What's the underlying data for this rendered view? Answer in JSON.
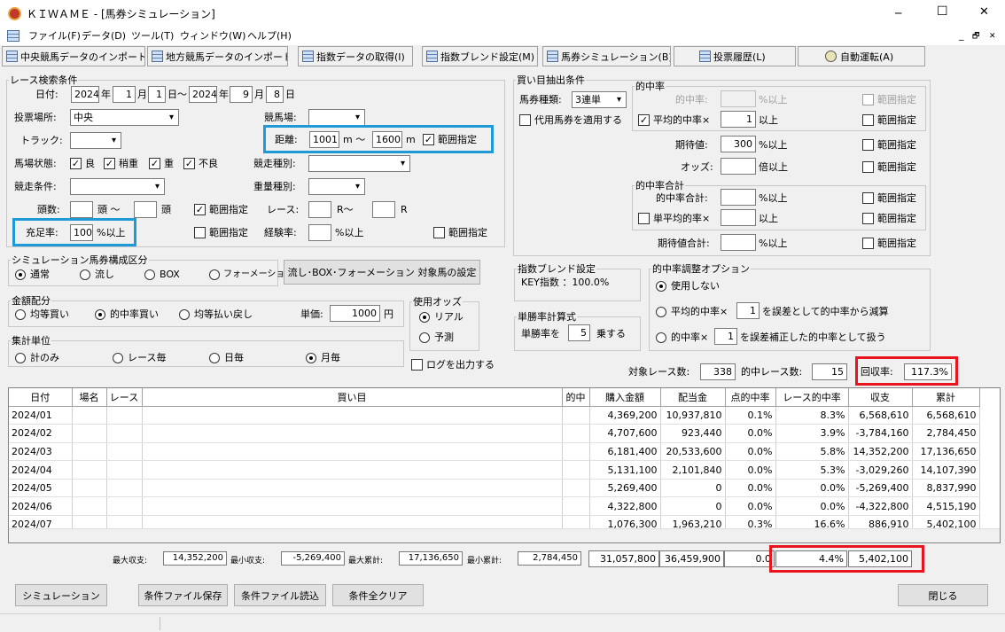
{
  "window": {
    "title": "ＫＩＷＡＭＥ - [馬券シミュレーション]",
    "minimize": "─",
    "maximize": "☐",
    "close": "✕"
  },
  "menu": {
    "items": [
      "ファイル(F)",
      "データ(D)",
      "ツール(T)",
      "ウィンドウ(W)",
      "ヘルプ(H)"
    ],
    "mdi": [
      "_",
      "🗗",
      "✕"
    ]
  },
  "toolbar": {
    "buttons": [
      "中央競馬データのインポート(J)",
      "地方競馬データのインポート(N)",
      "指数データの取得(I)",
      "指数ブレンド設定(M)",
      "馬券シミュレーション(B)",
      "投票履歴(L)",
      "自動運転(A)"
    ]
  },
  "race": {
    "legend": "レース検索条件",
    "date_label": "日付:",
    "from_year": "2024",
    "year1": "年",
    "from_month": "1",
    "month1": "月",
    "from_day": "1",
    "day_tilde": "日〜",
    "to_year": "2024",
    "year2": "年",
    "to_month": "9",
    "month2": "月",
    "to_day": "8",
    "day2": "日",
    "venue_label": "投票場所:",
    "venue_value": "中央",
    "track_label": "トラック:",
    "track_value": "",
    "course_label": "競馬場:",
    "course_value": "",
    "distance_label": "距離:",
    "distance_from": "1001",
    "m1": "m 〜",
    "distance_to": "1600",
    "m2": "m",
    "distance_range": "範囲指定",
    "condition_label": "馬場状態:",
    "conditions": [
      "良",
      "稍重",
      "重",
      "不良"
    ],
    "race_type_label": "競走種別:",
    "race_cond_label": "競走条件:",
    "weight_label": "重量種別:",
    "heads_label": "頭数:",
    "heads_tilde": "頭 〜",
    "heads_unit": "頭",
    "heads_range": "範囲指定",
    "race_no_label": "レース:",
    "race_r1": "R〜",
    "race_r2": "R",
    "fill_label": "充足率:",
    "fill_value": "100",
    "fill_unit": "%以上",
    "fill_range": "範囲指定",
    "exp_label": "経験率:",
    "exp_unit": "%以上",
    "exp_range": "範囲指定"
  },
  "buy": {
    "legend": "買い目抽出条件",
    "type_label": "馬券種類:",
    "type_value": "3連単",
    "substitute": "代用馬券を適用する",
    "hit_legend": "的中率",
    "hit_rate_label": "的中率:",
    "hit_rate_unit": "%以上",
    "avg_hit_label": "平均的中率×",
    "avg_hit_value": "1",
    "avg_hit_unit": "以上",
    "expect_label": "期待値:",
    "expect_value": "300",
    "expect_unit": "%以上",
    "odds_label": "オッズ:",
    "odds_unit": "倍以上",
    "sum_legend": "的中率合計",
    "sum_hit_label": "的中率合計:",
    "sum_hit_unit": "%以上",
    "single_avg_label": "単平均的率×",
    "single_avg_unit": "以上",
    "expect_sum_label": "期待値合計:",
    "expect_sum_unit": "%以上",
    "range": "範囲指定"
  },
  "sim": {
    "legend": "シミュレーション馬券構成区分",
    "options": [
      "通常",
      "流し",
      "BOX",
      "フォーメーション"
    ],
    "target_button": "流し･BOX･フォーメーション 対象馬の設定"
  },
  "money": {
    "legend": "金額配分",
    "options": [
      "均等買い",
      "的中率買い",
      "均等払い戻し"
    ],
    "unit_label": "単価:",
    "unit_value": "1000",
    "unit_yen": "円"
  },
  "odds": {
    "legend": "使用オッズ",
    "options": [
      "リアル",
      "予測"
    ]
  },
  "agg": {
    "legend": "集計単位",
    "options": [
      "計のみ",
      "レース毎",
      "日毎",
      "月毎"
    ]
  },
  "log": {
    "label": "ログを出力する"
  },
  "blend": {
    "legend": "指数ブレンド設定",
    "text": "KEY指数 ：100.0%"
  },
  "win": {
    "legend": "単勝率計算式",
    "label": "単勝率を",
    "value": "5",
    "unit": "乗する"
  },
  "adj": {
    "legend": "的中率調整オプション",
    "opt1": "使用しない",
    "opt2_pre": "平均的中率×",
    "opt2_val": "1",
    "opt2_post": "を誤差として的中率から減算",
    "opt3_pre": "的中率×",
    "opt3_val": "1",
    "opt3_post": "を誤差補正した的中率として扱う"
  },
  "summary": {
    "target_label": "対象レース数:",
    "target_value": "338",
    "hit_label": "的中レース数:",
    "hit_value": "15",
    "recovery_label": "回収率:",
    "recovery_value": "117.3%"
  },
  "table": {
    "headers": [
      "日付",
      "場名",
      "レース",
      "買い目",
      "的中",
      "購入金額",
      "配当金",
      "点的中率",
      "レース的中率",
      "収支",
      "累計"
    ],
    "rows": [
      [
        "2024/01",
        "",
        "",
        "",
        "",
        "4,369,200",
        "10,937,810",
        "0.1%",
        "8.3%",
        "6,568,610",
        "6,568,610"
      ],
      [
        "2024/02",
        "",
        "",
        "",
        "",
        "4,707,600",
        "923,440",
        "0.0%",
        "3.9%",
        "-3,784,160",
        "2,784,450"
      ],
      [
        "2024/03",
        "",
        "",
        "",
        "",
        "6,181,400",
        "20,533,600",
        "0.0%",
        "5.8%",
        "14,352,200",
        "17,136,650"
      ],
      [
        "2024/04",
        "",
        "",
        "",
        "",
        "5,131,100",
        "2,101,840",
        "0.0%",
        "5.3%",
        "-3,029,260",
        "14,107,390"
      ],
      [
        "2024/05",
        "",
        "",
        "",
        "",
        "5,269,400",
        "0",
        "0.0%",
        "0.0%",
        "-5,269,400",
        "8,837,990"
      ],
      [
        "2024/06",
        "",
        "",
        "",
        "",
        "4,322,800",
        "0",
        "0.0%",
        "0.0%",
        "-4,322,800",
        "4,515,190"
      ],
      [
        "2024/07",
        "",
        "",
        "",
        "",
        "1,076,300",
        "1,963,210",
        "0.3%",
        "16.6%",
        "886,910",
        "5,402,100"
      ]
    ]
  },
  "totals": {
    "max_income_label": "最大収支:",
    "max_income": "14,352,200",
    "min_income_label": "最小収支:",
    "min_income": "-5,269,400",
    "max_cum_label": "最大累計:",
    "max_cum": "17,136,650",
    "min_cum_label": "最小累計:",
    "min_cum": "2,784,450",
    "purchase": "31,057,800",
    "payout": "36,459,900",
    "point_hit": "0.0",
    "race_hit": "4.4%",
    "balance": "5,402,100"
  },
  "bottom": {
    "simulate": "シミュレーション",
    "save": "条件ファイル保存",
    "load": "条件ファイル読込",
    "clear": "条件全クリア",
    "close": "閉じる"
  },
  "colors": {
    "highlight_red": "#e8141e",
    "highlight_blue": "#1f9ad6"
  }
}
